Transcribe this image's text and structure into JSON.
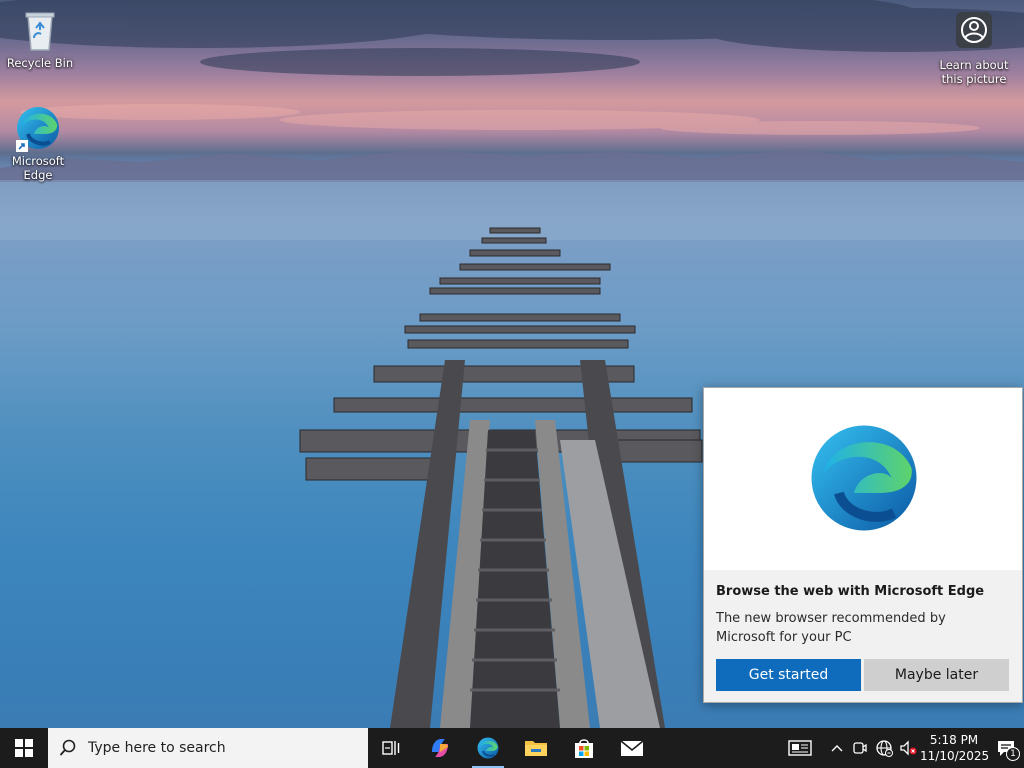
{
  "desktop": {
    "icons": [
      {
        "label": "Recycle Bin",
        "icon": "recycle-bin-icon"
      },
      {
        "label": "Microsoft Edge",
        "icon": "edge-icon"
      },
      {
        "label": "Learn about this picture",
        "icon": "camera-icon"
      }
    ]
  },
  "popup": {
    "title": "Browse the web with Microsoft Edge",
    "body": "The new browser recommended by Microsoft for your PC",
    "primary_label": "Get started",
    "secondary_label": "Maybe later"
  },
  "taskbar": {
    "start_icon": "windows-logo-icon",
    "search_placeholder": "Type here to search",
    "apps": [
      {
        "name": "Task View",
        "icon": "task-view-icon"
      },
      {
        "name": "Copilot",
        "icon": "copilot-icon"
      },
      {
        "name": "Microsoft Edge",
        "icon": "edge-icon"
      },
      {
        "name": "File Explorer",
        "icon": "file-explorer-icon"
      },
      {
        "name": "Microsoft Store",
        "icon": "store-icon"
      },
      {
        "name": "Mail",
        "icon": "mail-icon"
      }
    ],
    "tray": {
      "time": "5:18 PM",
      "date": "11/10/2025",
      "notification_count": "1"
    }
  },
  "colors": {
    "accent": "#0f6cbd",
    "taskbar": "#1c1c1c",
    "secondary_button": "#cfcfcf"
  }
}
